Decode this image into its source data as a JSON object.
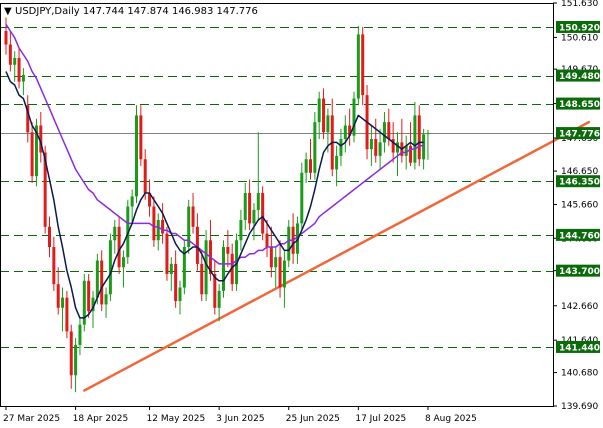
{
  "header": {
    "symbol_line": "USDJPY,Daily  147.744 147.874 146.983 147.776",
    "open_triangle": "▼"
  },
  "colors": {
    "background": "#ffffff",
    "axis": "#000000",
    "candle_up": "#1a9c1a",
    "candle_down": "#e01b1b",
    "ma_fast": "#0a1a4d",
    "ma_slow": "#8a2be2",
    "trendline": "#f0673a",
    "level_line": "#0b6b0b",
    "level_tag": "#0b6b0b",
    "current_tag": "#0b6b0b",
    "current_line": "#808080"
  },
  "chart_data": {
    "type": "candlestick",
    "symbol": "USDJPY",
    "timeframe": "Daily",
    "ohlc_header": {
      "open": 147.744,
      "high": 147.874,
      "low": 146.983,
      "close": 147.776
    },
    "y_axis": {
      "range": [
        139.69,
        151.63
      ],
      "tick_labels": [
        "151.630",
        "150.610",
        "149.670",
        "148.650",
        "147.630",
        "146.650",
        "145.660",
        "144.660",
        "143.700",
        "142.660",
        "141.640",
        "140.680",
        "139.690"
      ]
    },
    "x_axis": {
      "labels": [
        "27 Mar 2025",
        "18 Apr 2025",
        "12 May 2025",
        "3 Jun 2025",
        "25 Jun 2025",
        "17 Jul 2025",
        "8 Aug 2025"
      ],
      "label_bar_index": [
        0,
        16,
        33,
        49,
        65,
        81,
        97
      ]
    },
    "levels": [
      {
        "value": 150.92,
        "label": "150.920"
      },
      {
        "value": 149.48,
        "label": "149.480"
      },
      {
        "value": 148.65,
        "label": "148.650"
      },
      {
        "value": 146.35,
        "label": "146.350"
      },
      {
        "value": 144.76,
        "label": "144.760"
      },
      {
        "value": 143.7,
        "label": "143.700"
      },
      {
        "value": 141.44,
        "label": "141.440"
      }
    ],
    "current_price": {
      "value": 147.776,
      "label": "147.776"
    },
    "trendline": {
      "from": {
        "bar": 18,
        "price": 140.15
      },
      "to": {
        "bar": 134,
        "price": 148.1
      }
    },
    "candles": [
      [
        150.8,
        151.2,
        150.1,
        150.4
      ],
      [
        150.4,
        150.8,
        149.6,
        149.8
      ],
      [
        149.8,
        150.2,
        149.3,
        150.0
      ],
      [
        150.0,
        150.3,
        149.1,
        149.3
      ],
      [
        149.3,
        149.7,
        148.9,
        149.5
      ],
      [
        148.6,
        148.9,
        147.5,
        147.8
      ],
      [
        147.8,
        148.1,
        146.3,
        146.5
      ],
      [
        146.5,
        148.2,
        146.2,
        148.0
      ],
      [
        148.0,
        148.4,
        146.9,
        147.2
      ],
      [
        147.2,
        147.4,
        144.8,
        145.0
      ],
      [
        145.0,
        145.3,
        144.1,
        144.4
      ],
      [
        144.4,
        144.7,
        143.1,
        143.3
      ],
      [
        143.3,
        143.8,
        142.4,
        142.6
      ],
      [
        142.6,
        143.2,
        141.9,
        142.9
      ],
      [
        142.9,
        143.1,
        141.7,
        141.9
      ],
      [
        141.9,
        142.1,
        140.2,
        140.6
      ],
      [
        140.6,
        141.7,
        140.1,
        141.5
      ],
      [
        141.5,
        142.3,
        141.2,
        142.1
      ],
      [
        142.1,
        143.6,
        141.9,
        143.4
      ],
      [
        143.4,
        143.6,
        142.3,
        142.5
      ],
      [
        142.5,
        143.1,
        142.0,
        142.9
      ],
      [
        142.9,
        144.2,
        142.7,
        144.0
      ],
      [
        144.0,
        144.3,
        142.5,
        142.7
      ],
      [
        142.7,
        143.2,
        142.3,
        143.0
      ],
      [
        143.0,
        144.8,
        142.8,
        144.6
      ],
      [
        144.6,
        145.2,
        144.2,
        145.0
      ],
      [
        145.0,
        145.3,
        143.6,
        143.8
      ],
      [
        143.8,
        144.3,
        143.2,
        144.1
      ],
      [
        144.1,
        145.8,
        143.9,
        145.6
      ],
      [
        145.6,
        146.1,
        145.1,
        145.9
      ],
      [
        145.9,
        148.6,
        145.7,
        148.3
      ],
      [
        148.3,
        148.6,
        146.8,
        147.0
      ],
      [
        147.0,
        147.3,
        145.8,
        146.0
      ],
      [
        146.0,
        146.4,
        145.3,
        145.6
      ],
      [
        145.6,
        145.9,
        144.4,
        144.6
      ],
      [
        144.6,
        145.4,
        144.3,
        145.2
      ],
      [
        145.2,
        145.7,
        144.5,
        144.8
      ],
      [
        144.8,
        145.0,
        143.4,
        143.6
      ],
      [
        143.6,
        144.1,
        143.1,
        143.9
      ],
      [
        143.9,
        144.3,
        142.6,
        142.8
      ],
      [
        142.8,
        143.4,
        142.4,
        143.2
      ],
      [
        143.2,
        144.6,
        143.0,
        144.4
      ],
      [
        144.4,
        145.8,
        144.2,
        145.6
      ],
      [
        145.6,
        146.0,
        144.8,
        145.0
      ],
      [
        145.0,
        145.4,
        143.7,
        143.9
      ],
      [
        143.9,
        144.3,
        142.8,
        143.0
      ],
      [
        143.0,
        144.9,
        142.8,
        144.6
      ],
      [
        144.6,
        145.2,
        143.4,
        143.6
      ],
      [
        143.6,
        144.0,
        142.4,
        142.6
      ],
      [
        142.6,
        143.3,
        142.2,
        143.1
      ],
      [
        143.1,
        144.6,
        142.9,
        144.4
      ],
      [
        144.4,
        144.9,
        143.8,
        144.2
      ],
      [
        144.2,
        144.5,
        143.1,
        143.3
      ],
      [
        143.3,
        144.8,
        143.1,
        144.6
      ],
      [
        144.6,
        145.5,
        144.3,
        145.2
      ],
      [
        145.2,
        146.3,
        144.9,
        146.0
      ],
      [
        146.0,
        146.4,
        144.9,
        145.1
      ],
      [
        145.1,
        145.7,
        144.6,
        145.5
      ],
      [
        145.5,
        147.8,
        145.2,
        146.0
      ],
      [
        146.0,
        146.2,
        144.6,
        144.8
      ],
      [
        144.8,
        145.2,
        144.1,
        144.4
      ],
      [
        144.4,
        145.0,
        143.5,
        143.8
      ],
      [
        143.8,
        144.4,
        143.2,
        144.1
      ],
      [
        144.1,
        144.6,
        142.9,
        143.2
      ],
      [
        143.2,
        144.3,
        142.6,
        144.0
      ],
      [
        144.0,
        145.2,
        143.8,
        145.0
      ],
      [
        145.0,
        145.4,
        143.9,
        144.2
      ],
      [
        144.2,
        145.3,
        143.9,
        145.1
      ],
      [
        145.1,
        146.9,
        144.9,
        146.6
      ],
      [
        146.6,
        147.2,
        146.3,
        147.0
      ],
      [
        147.0,
        147.6,
        146.4,
        146.6
      ],
      [
        146.6,
        148.4,
        146.4,
        148.1
      ],
      [
        148.1,
        149.0,
        147.6,
        148.8
      ],
      [
        148.8,
        149.1,
        147.6,
        147.8
      ],
      [
        147.8,
        148.5,
        147.2,
        148.3
      ],
      [
        148.3,
        148.8,
        146.5,
        146.7
      ],
      [
        146.7,
        147.4,
        146.2,
        147.1
      ],
      [
        147.1,
        147.9,
        146.8,
        147.6
      ],
      [
        147.6,
        148.3,
        147.2,
        148.0
      ],
      [
        148.0,
        148.5,
        147.4,
        147.7
      ],
      [
        147.7,
        149.0,
        147.5,
        148.8
      ],
      [
        148.8,
        150.95,
        148.6,
        150.7
      ],
      [
        150.7,
        150.92,
        148.6,
        148.9
      ],
      [
        148.9,
        149.2,
        147.0,
        147.3
      ],
      [
        147.3,
        148.0,
        146.8,
        147.6
      ],
      [
        147.6,
        148.2,
        146.9,
        147.1
      ],
      [
        147.1,
        147.9,
        146.7,
        147.5
      ],
      [
        147.5,
        148.4,
        147.2,
        148.1
      ],
      [
        148.1,
        148.5,
        147.4,
        147.6
      ],
      [
        147.6,
        148.1,
        146.9,
        147.2
      ],
      [
        147.2,
        147.8,
        146.5,
        147.5
      ],
      [
        147.5,
        148.2,
        146.9,
        147.1
      ],
      [
        147.1,
        147.7,
        146.7,
        147.4
      ],
      [
        147.4,
        148.1,
        146.8,
        146.9
      ],
      [
        146.9,
        148.7,
        146.7,
        148.3
      ],
      [
        148.3,
        148.6,
        146.8,
        147.0
      ],
      [
        147.0,
        147.9,
        146.7,
        147.74
      ],
      [
        147.744,
        147.874,
        146.983,
        147.776
      ]
    ],
    "ma_fast": [
      149.6,
      149.3,
      149.2,
      148.9,
      148.8,
      148.4,
      148.0,
      147.8,
      147.5,
      147.0,
      146.4,
      145.8,
      145.0,
      144.4,
      143.7,
      143.2,
      142.6,
      142.3,
      142.3,
      142.4,
      142.6,
      142.9,
      143.2,
      143.4,
      143.6,
      144.0,
      144.3,
      144.5,
      144.8,
      145.1,
      145.5,
      145.8,
      146.0,
      146.0,
      145.8,
      145.6,
      145.4,
      145.1,
      144.8,
      144.5,
      144.3,
      144.2,
      144.3,
      144.4,
      144.4,
      144.2,
      143.9,
      143.7,
      143.5,
      143.4,
      143.4,
      143.6,
      143.8,
      143.9,
      144.2,
      144.5,
      144.8,
      145.0,
      145.2,
      145.3,
      145.1,
      144.9,
      144.7,
      144.5,
      144.3,
      144.3,
      144.5,
      144.6,
      144.9,
      145.2,
      145.6,
      146.1,
      146.7,
      147.2,
      147.4,
      147.5,
      147.5,
      147.4,
      147.5,
      147.7,
      148.0,
      148.3,
      148.2,
      148.1,
      148.0,
      147.9,
      147.8,
      147.7,
      147.6,
      147.5,
      147.4,
      147.3,
      147.4,
      147.5,
      147.4,
      147.5,
      147.5
    ],
    "ma_slow": [
      151.0,
      150.8,
      150.6,
      150.3,
      150.1,
      149.9,
      149.6,
      149.4,
      149.1,
      148.8,
      148.5,
      148.2,
      147.9,
      147.6,
      147.3,
      147.0,
      146.7,
      146.5,
      146.3,
      146.1,
      146.0,
      145.8,
      145.7,
      145.6,
      145.5,
      145.4,
      145.3,
      145.2,
      145.1,
      145.1,
      145.1,
      145.1,
      145.1,
      145.1,
      145.0,
      145.0,
      144.9,
      144.9,
      144.8,
      144.8,
      144.7,
      144.6,
      144.6,
      144.5,
      144.4,
      144.3,
      144.2,
      144.1,
      144.0,
      143.9,
      143.9,
      143.9,
      143.9,
      144.0,
      144.1,
      144.1,
      144.2,
      144.2,
      144.3,
      144.3,
      144.4,
      144.4,
      144.4,
      144.5,
      144.5,
      144.6,
      144.6,
      144.7,
      144.8,
      144.9,
      145.0,
      145.1,
      145.3,
      145.4,
      145.5,
      145.6,
      145.7,
      145.8,
      145.9,
      146.0,
      146.1,
      146.2,
      146.3,
      146.4,
      146.5,
      146.6,
      146.7,
      146.8,
      146.9,
      147.0,
      147.1,
      147.2,
      147.2,
      147.3,
      147.3,
      147.4,
      147.4
    ]
  }
}
